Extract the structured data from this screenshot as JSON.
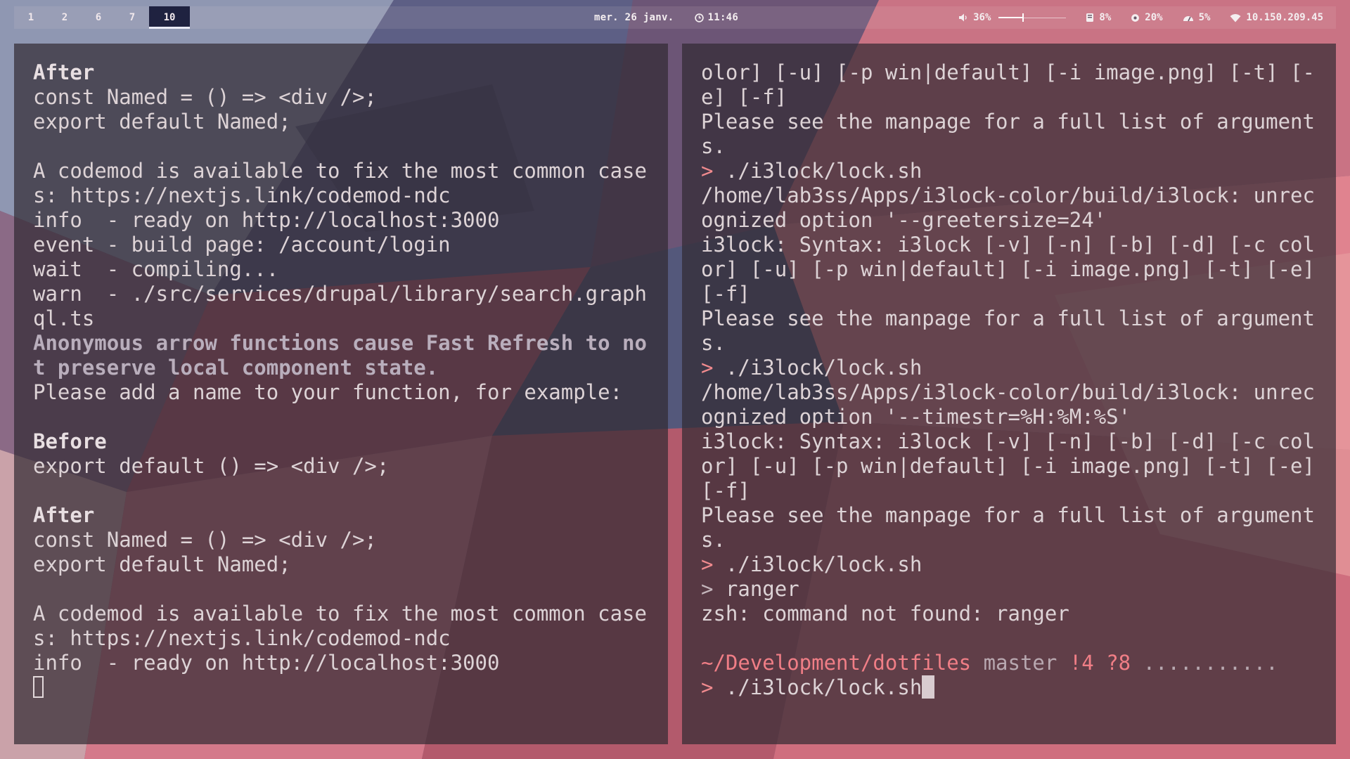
{
  "colors": {
    "topbar_active_ws": "#1f2240",
    "terminal_bg": "#302a32",
    "terminal_fg": "#ddd3d6",
    "prompt_accent": "#f08a8e"
  },
  "topbar": {
    "workspaces": [
      "1",
      "2",
      "6",
      "7",
      "10"
    ],
    "active_workspace": "10",
    "date": "mer. 26 janv.",
    "time": "11:46",
    "clock_icon": "clock-icon",
    "volume": {
      "icon": "speaker-icon",
      "label": "36%",
      "level": 0.36
    },
    "disk": {
      "icon": "disk-icon",
      "label": "8%"
    },
    "cpu": {
      "icon": "cpu-icon",
      "label": "20%"
    },
    "memory": {
      "icon": "gauge-icon",
      "label": "5%"
    },
    "network": {
      "icon": "wifi-icon",
      "label": "10.150.209.45"
    }
  },
  "left_terminal": {
    "lines": [
      {
        "style": "bold",
        "text": "After"
      },
      {
        "style": "normal",
        "text": "const Named = () => <div />;"
      },
      {
        "style": "normal",
        "text": "export default Named;"
      },
      {
        "style": "normal",
        "text": ""
      },
      {
        "style": "normal",
        "text": "A codemod is available to fix the most common cases: https://nextjs.link/codemod-ndc"
      },
      {
        "style": "normal",
        "text": "info  - ready on http://localhost:3000"
      },
      {
        "style": "normal",
        "text": "event - build page: /account/login"
      },
      {
        "style": "normal",
        "text": "wait  - compiling..."
      },
      {
        "style": "normal",
        "text": "warn  - ./src/services/drupal/library/search.graphql.ts"
      },
      {
        "style": "hint",
        "text": "Anonymous arrow functions cause Fast Refresh to not preserve local component state."
      },
      {
        "style": "normal",
        "text": "Please add a name to your function, for example:"
      },
      {
        "style": "normal",
        "text": ""
      },
      {
        "style": "bold",
        "text": "Before"
      },
      {
        "style": "normal",
        "text": "export default () => <div />;"
      },
      {
        "style": "normal",
        "text": ""
      },
      {
        "style": "bold",
        "text": "After"
      },
      {
        "style": "normal",
        "text": "const Named = () => <div />;"
      },
      {
        "style": "normal",
        "text": "export default Named;"
      },
      {
        "style": "normal",
        "text": ""
      },
      {
        "style": "normal",
        "text": "A codemod is available to fix the most common cases: https://nextjs.link/codemod-ndc"
      },
      {
        "style": "normal",
        "text": "info  - ready on http://localhost:3000"
      }
    ]
  },
  "right_terminal": {
    "lines": [
      {
        "style": "normal",
        "text": "olor] [-u] [-p win|default] [-i image.png] [-t] [-e] [-f]"
      },
      {
        "style": "normal",
        "text": "Please see the manpage for a full list of arguments."
      },
      {
        "style": "prompt",
        "prompt": "> ",
        "text": "./i3lock/lock.sh"
      },
      {
        "style": "normal",
        "text": "/home/lab3ss/Apps/i3lock-color/build/i3lock: unrecognized option '--greetersize=24'"
      },
      {
        "style": "normal",
        "text": "i3lock: Syntax: i3lock [-v] [-n] [-b] [-d] [-c color] [-u] [-p win|default] [-i image.png] [-t] [-e] [-f]"
      },
      {
        "style": "normal",
        "text": "Please see the manpage for a full list of arguments."
      },
      {
        "style": "prompt",
        "prompt": "> ",
        "text": "./i3lock/lock.sh"
      },
      {
        "style": "normal",
        "text": "/home/lab3ss/Apps/i3lock-color/build/i3lock: unrecognized option '--timestr=%H:%M:%S'"
      },
      {
        "style": "normal",
        "text": "i3lock: Syntax: i3lock [-v] [-n] [-b] [-d] [-c color] [-u] [-p win|default] [-i image.png] [-t] [-e] [-f]"
      },
      {
        "style": "normal",
        "text": "Please see the manpage for a full list of arguments."
      },
      {
        "style": "prompt",
        "prompt": "> ",
        "text": "./i3lock/lock.sh"
      },
      {
        "style": "prompt-dim",
        "prompt": "> ",
        "text": "ranger"
      },
      {
        "style": "normal",
        "text": "zsh: command not found: ranger"
      },
      {
        "style": "normal",
        "text": ""
      }
    ],
    "status_line": {
      "path": "~/Development/dotfiles",
      "branch": "master",
      "git_status": "!4 ?8",
      "dots": "..........."
    },
    "current_prompt": "> ",
    "current_input": "./i3lock/lock.sh"
  }
}
